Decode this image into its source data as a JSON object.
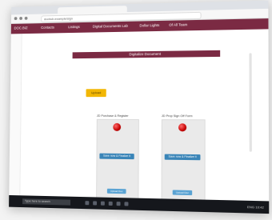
{
  "browser": {
    "tab_title": "Sign Doc...",
    "address": "dochub.example/sign"
  },
  "menu": {
    "items": [
      {
        "label": "DOC.BIZ"
      },
      {
        "label": "Contacts"
      },
      {
        "label": "Listings"
      },
      {
        "label": "Digital Documents Lab"
      },
      {
        "label": "Dollar Lights"
      },
      {
        "label": "Of All Team"
      }
    ]
  },
  "page": {
    "title": "Digitalize Document",
    "yellow_button": "Upload"
  },
  "panels": [
    {
      "label": "JD Purchase & Register",
      "primary_button": "Save now & Finalize it",
      "secondary_button": "Upload Doc"
    },
    {
      "label": "JD Prop Sign Off Form",
      "primary_button": "Save now & Finalize it",
      "secondary_button": "Upload Doc"
    }
  ],
  "taskbar": {
    "search_text": "Type here to search",
    "tray_text": "ENG 10:42"
  },
  "colors": {
    "menu_bg": "#7b2a43",
    "yellow": "#f2b705",
    "blue": "#3a85b8"
  }
}
